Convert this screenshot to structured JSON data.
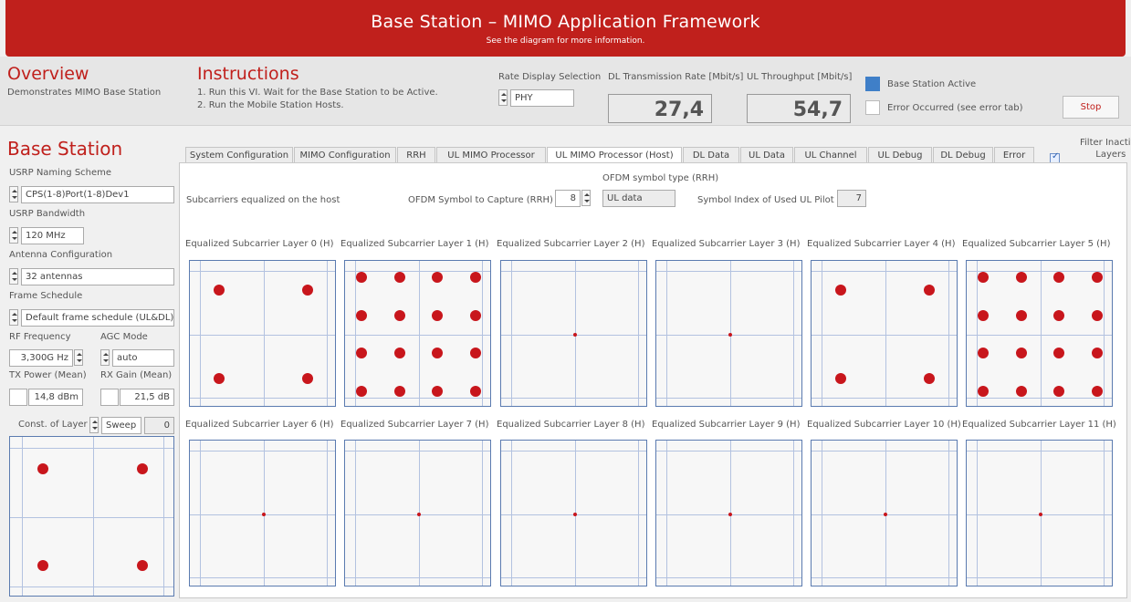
{
  "header": {
    "title": "Base Station – MIMO Application Framework",
    "subtitle": "See the diagram for more information."
  },
  "overview": {
    "heading": "Overview",
    "description": "Demonstrates MIMO Base Station"
  },
  "instructions": {
    "heading": "Instructions",
    "line1": "1. Run this VI. Wait for the Base Station to be Active.",
    "line2": "2. Run the Mobile Station Hosts."
  },
  "rate_display": {
    "label": "Rate Display Selection",
    "value": "PHY"
  },
  "dl_rate": {
    "label": "DL Transmission Rate [Mbit/s]",
    "value": "27,4"
  },
  "ul_throughput": {
    "label": "UL Throughput [Mbit/s]",
    "value": "54,7"
  },
  "status": {
    "base_station_active": "Base Station Active",
    "error_occurred": "Error Occurred (see error tab)",
    "active_color": "#3f7fc8"
  },
  "stop_label": "Stop",
  "left": {
    "heading": "Base Station",
    "usrp_naming_label": "USRP Naming Scheme",
    "usrp_naming_value": "CPS(1-8)Port(1-8)Dev1",
    "usrp_bw_label": "USRP Bandwidth",
    "usrp_bw_value": "120 MHz",
    "antenna_label": "Antenna Configuration",
    "antenna_value": "32 antennas",
    "frame_label": "Frame Schedule",
    "frame_value": "Default frame schedule (UL&DL)",
    "rf_label": "RF Frequency",
    "rf_value": "3,300G Hz",
    "agc_label": "AGC Mode",
    "agc_value": "auto",
    "tx_label": "TX Power (Mean)",
    "tx_value": "14,8 dBm",
    "rx_label": "RX Gain (Mean)",
    "rx_value": "21,5 dB",
    "const_label": "Const. of Layer",
    "const_mode": "Sweep",
    "const_index": "0"
  },
  "tabs": [
    "System Configuration",
    "MIMO Configuration",
    "RRH",
    "UL MIMO Processor",
    "UL MIMO Processor (Host)",
    "DL Data",
    "UL Data",
    "UL Channel",
    "UL Debug",
    "DL Debug",
    "Error"
  ],
  "filter": {
    "label_line1": "Filter Inactive",
    "label_line2": "Layers"
  },
  "controls": {
    "subcarriers_label": "Subcarriers equalized on the host",
    "ofdm_capture_label": "OFDM Symbol to Capture (RRH)",
    "ofdm_capture_value": "8",
    "ofdm_type_label": "OFDM symbol type (RRH)",
    "ofdm_type_value": "UL data",
    "pilot_label": "Symbol Index of Used UL Pilot",
    "pilot_value": "7"
  },
  "plots": [
    {
      "title": "Equalized Subcarrier Layer 0 (H)",
      "constellation": "qpsk"
    },
    {
      "title": "Equalized Subcarrier Layer 1 (H)",
      "constellation": "16qam"
    },
    {
      "title": "Equalized Subcarrier Layer 2 (H)",
      "constellation": "center"
    },
    {
      "title": "Equalized Subcarrier Layer 3 (H)",
      "constellation": "center"
    },
    {
      "title": "Equalized Subcarrier Layer 4 (H)",
      "constellation": "qpsk"
    },
    {
      "title": "Equalized Subcarrier Layer 5 (H)",
      "constellation": "16qam"
    },
    {
      "title": "Equalized Subcarrier Layer 6 (H)",
      "constellation": "center"
    },
    {
      "title": "Equalized Subcarrier Layer 7 (H)",
      "constellation": "center"
    },
    {
      "title": "Equalized Subcarrier Layer 8 (H)",
      "constellation": "center"
    },
    {
      "title": "Equalized Subcarrier Layer 9 (H)",
      "constellation": "center"
    },
    {
      "title": "Equalized Subcarrier Layer 10 (H)",
      "constellation": "center"
    },
    {
      "title": "Equalized Subcarrier Layer 11 (H)",
      "constellation": "center"
    }
  ],
  "left_plot": {
    "constellation": "qpsk"
  },
  "marker_color": "#c8161c"
}
